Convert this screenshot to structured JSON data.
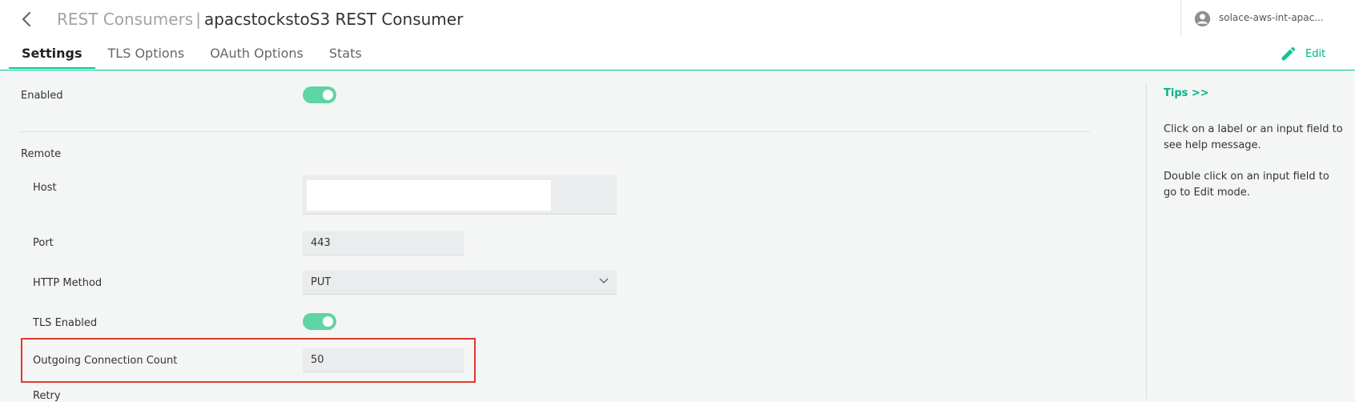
{
  "header": {
    "breadcrumb": "REST Consumers",
    "separator": "|",
    "title": "apacstockstoS3 REST Consumer",
    "user": "solace-aws-int-apac...",
    "edit_label": "Edit"
  },
  "tabs": [
    {
      "label": "Settings",
      "active": true
    },
    {
      "label": "TLS Options",
      "active": false
    },
    {
      "label": "OAuth Options",
      "active": false
    },
    {
      "label": "Stats",
      "active": false
    }
  ],
  "form": {
    "enabled_label": "Enabled",
    "enabled_value": true,
    "remote_label": "Remote",
    "host_label": "Host",
    "host_value": "",
    "port_label": "Port",
    "port_value": "443",
    "http_method_label": "HTTP Method",
    "http_method_value": "PUT",
    "tls_enabled_label": "TLS Enabled",
    "tls_enabled_value": true,
    "outgoing_label": "Outgoing Connection Count",
    "outgoing_value": "50",
    "retry_label": "Retry"
  },
  "sidebar": {
    "tips_link": "Tips >>",
    "tip1": "Click on a label or an input field to see help message.",
    "tip2": "Double click on an input field to go to Edit mode."
  },
  "colors": {
    "accent": "#00c895",
    "toggle_on": "#5fd4a5",
    "highlight": "#e0392b"
  }
}
